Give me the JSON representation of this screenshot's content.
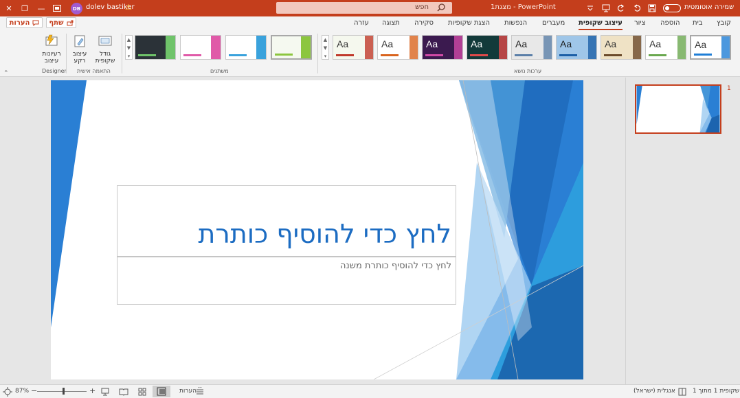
{
  "titlebar": {
    "autosave_label": "שמירה אוטומטית",
    "filename": "מצגת1 - PowerPoint",
    "search_placeholder": "חפש",
    "user_initials": "DB",
    "user_name": "dolev bastiker",
    "warning_glyph": "⚠",
    "icons": [
      "autosave-toggle",
      "save-icon",
      "undo-icon",
      "redo-icon",
      "present-icon",
      "customize-icon",
      "ribbon-options-icon",
      "minimize-icon",
      "restore-icon",
      "close-icon"
    ]
  },
  "tabs": {
    "file": "קובץ",
    "home": "בית",
    "insert": "הוספה",
    "draw": "ציור",
    "design": "עיצוב שקופית",
    "transitions": "מעברים",
    "animations": "הנפשות",
    "slideshow": "הצגת שקופיות",
    "review": "סקירה",
    "view": "תצוגה",
    "help": "עזרה",
    "share": "שתף",
    "comments": "הערות",
    "active": "design"
  },
  "ribbon": {
    "themes_group": "ערכות נושא",
    "variants_group": "משתנים",
    "customize_group": "התאמה אישית",
    "designer_group": "Designer",
    "slide_size_label": "גודל שקופית",
    "format_background_label": "עיצוב רקע",
    "design_ideas_label": "רעיונות עיצוב",
    "theme_glyph": "Aa",
    "themes": [
      {
        "name": "office",
        "bg": "#ffffff",
        "accent": "#1f7ed6",
        "text": "#333333",
        "selected": true
      },
      {
        "name": "facet-white",
        "bg": "#ffffff",
        "accent": "#6aa84f",
        "text": "#333333",
        "selected": false
      },
      {
        "name": "wood",
        "bg": "#efe2c5",
        "accent": "#6b4a2a",
        "text": "#333333",
        "selected": false
      },
      {
        "name": "blue-pattern",
        "bg": "#9fc6e8",
        "accent": "#1c5fa6",
        "text": "#1a1a1a",
        "selected": false
      },
      {
        "name": "gray",
        "bg": "#e8e8e8",
        "accent": "#5b7fa8",
        "text": "#222222",
        "selected": false
      },
      {
        "name": "dark-teal",
        "bg": "#123a3a",
        "accent": "#e04a4a",
        "text": "#ffffff",
        "selected": false
      },
      {
        "name": "purple",
        "bg": "#3b1a4f",
        "accent": "#d04aa6",
        "text": "#ffffff",
        "selected": false
      },
      {
        "name": "white-orange",
        "bg": "#ffffff",
        "accent": "#d9641e",
        "text": "#333333",
        "selected": false
      },
      {
        "name": "green-red",
        "bg": "#f5f8ee",
        "accent": "#c0392b",
        "text": "#333333",
        "selected": false
      }
    ],
    "variants": [
      {
        "name": "variant-green",
        "bg": "#f5f9f0",
        "accent": "#8cc63f"
      },
      {
        "name": "variant-blue",
        "bg": "#ffffff",
        "accent": "#3aa2dc"
      },
      {
        "name": "variant-pink",
        "bg": "#ffffff",
        "accent": "#e05aa8"
      },
      {
        "name": "variant-dark",
        "bg": "#2b3238",
        "accent": "#6fc36a"
      }
    ]
  },
  "slide": {
    "title_placeholder": "לחץ כדי להוסיף כותרת",
    "subtitle_placeholder": "לחץ כדי להוסיף כותרת משנה",
    "accent_dark": "#1a5fa8",
    "accent_mid": "#2a7fd4",
    "accent_light": "#6bb8ea"
  },
  "thumbnails": {
    "slide_number": "1"
  },
  "statusbar": {
    "slide_info": "שקופית 1 מתוך 1",
    "language": "אנגלית (ישראל)",
    "notes": "הערות",
    "zoom": "87%",
    "zoom_level": 0.52,
    "zoom_minus": "−",
    "zoom_plus": "+"
  }
}
